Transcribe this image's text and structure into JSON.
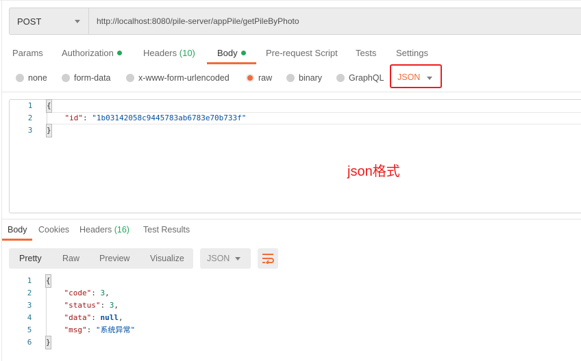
{
  "request": {
    "method": "POST",
    "url": "http://localhost:8080/pile-server/appPile/getPileByPhoto",
    "tabs": [
      {
        "label": "Params"
      },
      {
        "label": "Authorization",
        "dot": true
      },
      {
        "label": "Headers",
        "count": "(10)"
      },
      {
        "label": "Body",
        "dot": true,
        "active": true
      },
      {
        "label": "Pre-request Script"
      },
      {
        "label": "Tests"
      },
      {
        "label": "Settings"
      }
    ],
    "body_types": [
      {
        "label": "none"
      },
      {
        "label": "form-data"
      },
      {
        "label": "x-www-form-urlencoded"
      },
      {
        "label": "raw",
        "selected": true
      },
      {
        "label": "binary"
      },
      {
        "label": "GraphQL"
      }
    ],
    "raw_language": "JSON",
    "editor": {
      "line_numbers": [
        "1",
        "2",
        "3"
      ],
      "open_brace": "{",
      "close_brace": "}",
      "id_key": "\"id\"",
      "id_value": "\"1b03142058c9445783ab6783e70b733f\""
    }
  },
  "annotation": "json格式",
  "response": {
    "tabs": [
      {
        "label": "Body",
        "active": true
      },
      {
        "label": "Cookies"
      },
      {
        "label": "Headers",
        "count": "(16)"
      },
      {
        "label": "Test Results"
      }
    ],
    "views": [
      "Pretty",
      "Raw",
      "Preview",
      "Visualize"
    ],
    "active_view": "Pretty",
    "format": "JSON",
    "wrap_icon": "wrap-lines-icon",
    "editor": {
      "line_numbers": [
        "1",
        "2",
        "3",
        "4",
        "5",
        "6"
      ],
      "open_brace": "{",
      "close_brace": "}",
      "fields": [
        {
          "key": "\"code\"",
          "value": "3",
          "type": "num"
        },
        {
          "key": "\"status\"",
          "value": "3",
          "type": "num"
        },
        {
          "key": "\"data\"",
          "value": "null",
          "type": "kw"
        },
        {
          "key": "\"msg\"",
          "value": "\"系统异常\"",
          "type": "str"
        }
      ]
    }
  },
  "colors": {
    "accent": "#f26b3a",
    "success_dot": "#26a65b",
    "annotation_red": "#ee1c1c"
  }
}
